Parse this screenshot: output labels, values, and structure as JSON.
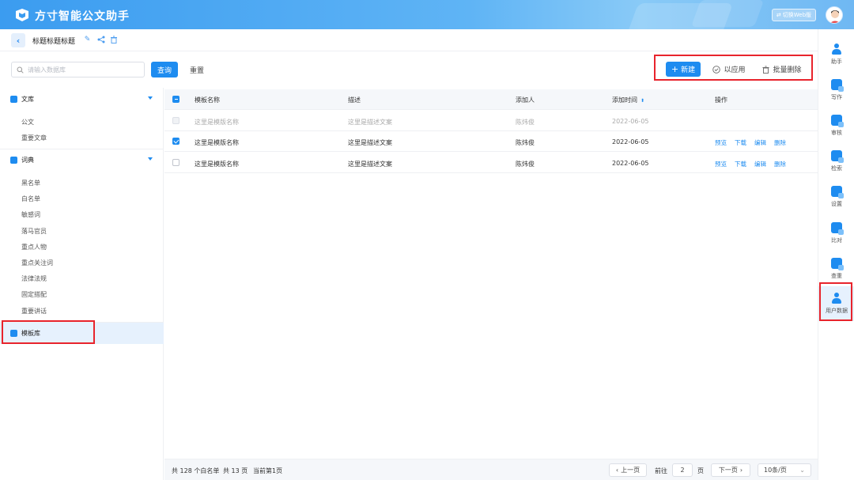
{
  "app": {
    "title": "方寸智能公文助手",
    "switch_label": "切换Web版"
  },
  "header": {
    "page_title": "标题标题标题"
  },
  "toolbar": {
    "search_placeholder": "请输入数据库",
    "query_label": "查询",
    "reset_label": "重置",
    "new_label": "新建",
    "applied_label": "以应用",
    "batch_delete_label": "批量删除"
  },
  "sidebar": {
    "groups": [
      {
        "label": "文库",
        "items": [
          "公文",
          "重要文章"
        ]
      },
      {
        "label": "词典",
        "items": [
          "黑名单",
          "白名单",
          "敏感词",
          "落马官员",
          "重点人物",
          "重点关注词",
          "法律法规",
          "固定搭配",
          "重要讲话"
        ]
      }
    ],
    "active_label": "模板库"
  },
  "table": {
    "columns": [
      "模板名称",
      "描述",
      "添加人",
      "添加时间",
      "操作"
    ],
    "rows": [
      {
        "name": "这里是模版名称",
        "desc": "这里是描述文案",
        "user": "陈炜俊",
        "time": "2022-06-05",
        "state": "disabled",
        "ops": []
      },
      {
        "name": "这里是模版名称",
        "desc": "这里是描述文案",
        "user": "陈炜俊",
        "time": "2022-06-05",
        "state": "checked",
        "ops": [
          "预览",
          "下载",
          "编辑",
          "删除"
        ]
      },
      {
        "name": "这里是模版名称",
        "desc": "这里是描述文案",
        "user": "陈炜俊",
        "time": "2022-06-05",
        "state": "unchecked",
        "ops": [
          "预览",
          "下载",
          "编辑",
          "删除"
        ]
      }
    ]
  },
  "footer": {
    "total_text": "共 128 个白名单",
    "pages_text": "共 13 页",
    "current_text": "当前第1页",
    "prev_label": "上一页",
    "goto_label": "前往",
    "page_value": "2",
    "page_unit": "页",
    "next_label": "下一页",
    "page_size_label": "10条/页"
  },
  "rail": {
    "items": [
      "助手",
      "写作",
      "审核",
      "检索",
      "设置",
      "比对",
      "查重",
      "用户数据"
    ]
  },
  "colors": {
    "primary": "#1e8cf0",
    "highlight_border": "#e8242c",
    "active_bg": "#e6f1fd"
  }
}
